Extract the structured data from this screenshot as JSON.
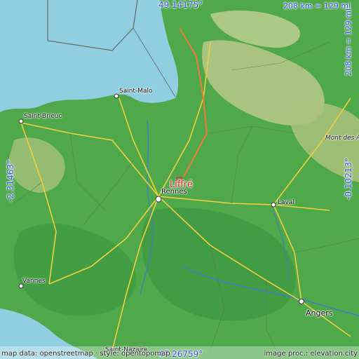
{
  "coordinates": {
    "top": "49.14175°",
    "bottom": "47.26759°",
    "left": "-2.31463°",
    "right": "-0.10213°"
  },
  "scale": {
    "top": "208 km = 129 mi",
    "side": "208 km = 129 mi"
  },
  "highlighted_place": {
    "name": "Liffré",
    "color": "#e03030"
  },
  "places": {
    "saint_malo": "Saint-Malo",
    "saint_brieuc": "Saint-Brieuc",
    "rennes": "Rennes",
    "laval": "Laval",
    "vannes": "Vannes",
    "angers": "Angers",
    "mont_des_avaloirs": "Mont des A",
    "saint_nazaire": "Saint-Nazaire"
  },
  "credits": {
    "map_data": "map data: openstreetmap · style: opentopomap",
    "image_proc": "image proc.: elevation.city"
  },
  "colors": {
    "sea": "#8fcfe0",
    "lowland": "#4fa84a",
    "highland": "#b8c98a",
    "roads_major": "#f0d040",
    "roads_motorway": "#f07a3a",
    "coord_text": "#3355ee"
  }
}
